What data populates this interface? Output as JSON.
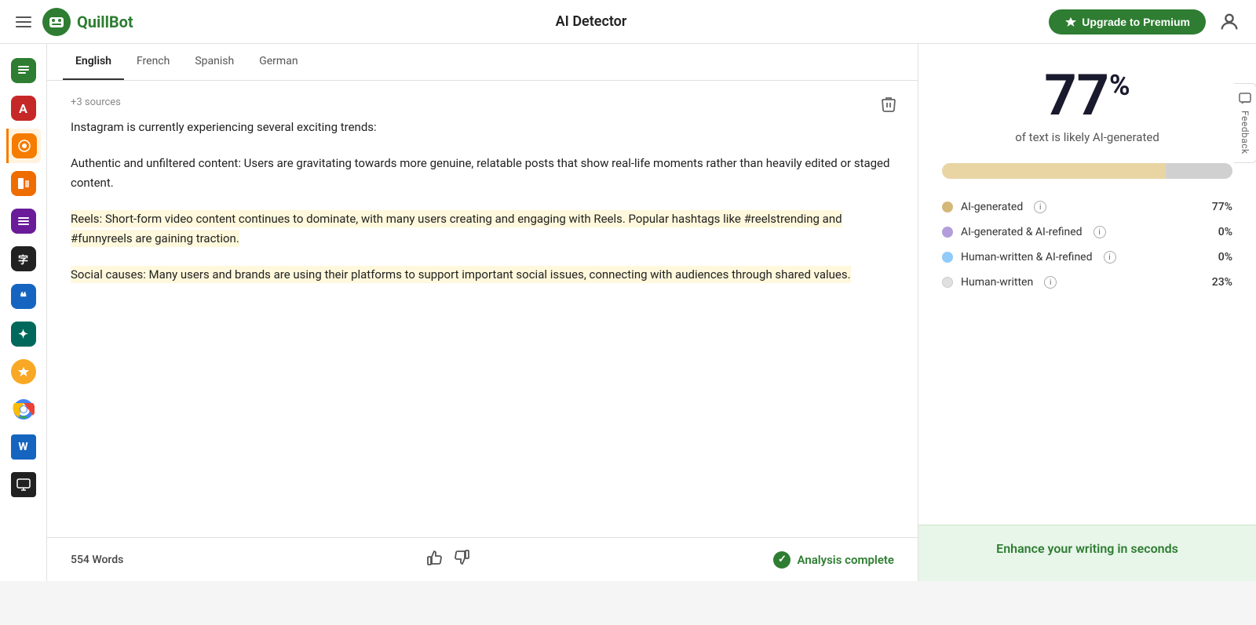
{
  "navbar": {
    "title": "AI Detector",
    "logo_text": "QuillBot",
    "upgrade_label": "Upgrade to Premium"
  },
  "tabs": [
    {
      "label": "English",
      "active": true
    },
    {
      "label": "French",
      "active": false
    },
    {
      "label": "Spanish",
      "active": false
    },
    {
      "label": "German",
      "active": false
    }
  ],
  "content": {
    "sources": "+3 sources",
    "paragraphs": [
      "Instagram is currently experiencing several exciting trends:",
      "Authentic and unfiltered content: Users are gravitating towards more genuine, relatable posts that show real-life moments rather than heavily edited or staged content.",
      "Reels: Short-form video content continues to dominate, with many users creating and engaging with Reels. Popular hashtags like #reelstrending and #funnyreels are gaining traction.",
      "Social causes: Many users and brands are using their platforms to support important social issues, connecting with audiences through shared values."
    ],
    "highlighted": [
      2,
      3
    ],
    "word_count": "554 Words",
    "analysis_status": "Analysis complete"
  },
  "results": {
    "percentage": "77",
    "percent_symbol": "%",
    "likelihood_text": "of text is likely AI-generated",
    "legend": [
      {
        "label": "AI-generated",
        "color": "dot-yellow",
        "value": "77%"
      },
      {
        "label": "AI-generated & AI-refined",
        "color": "dot-purple",
        "value": "0%"
      },
      {
        "label": "Human-written & AI-refined",
        "color": "dot-blue",
        "value": "0%"
      },
      {
        "label": "Human-written",
        "color": "dot-gray",
        "value": "23%"
      }
    ],
    "progress_ai_pct": 77,
    "progress_human_pct": 23
  },
  "promo": {
    "text": "Enhance your writing in seconds"
  },
  "feedback": {
    "label": "Feedback"
  },
  "sidebar": {
    "items": [
      {
        "icon": "📝",
        "class": "ic-green",
        "name": "summarizer"
      },
      {
        "icon": "A",
        "class": "ic-red",
        "name": "grammar-checker"
      },
      {
        "icon": "⊕",
        "class": "ic-orange",
        "name": "ai-detector",
        "active": true
      },
      {
        "icon": "◧",
        "class": "ic-orange2",
        "name": "paraphraser"
      },
      {
        "icon": "≡",
        "class": "ic-purple",
        "name": "text-tools"
      },
      {
        "icon": "字",
        "class": "ic-dark",
        "name": "translator"
      },
      {
        "icon": "❝",
        "class": "ic-blue",
        "name": "citation"
      },
      {
        "icon": "✦",
        "class": "ic-teal",
        "name": "ai-writer"
      },
      {
        "icon": "◆",
        "class": "ic-yellow",
        "name": "premium"
      },
      {
        "icon": "⊕",
        "class": "ic-chrome",
        "name": "chrome-ext"
      },
      {
        "icon": "W",
        "class": "ic-word",
        "name": "word-plugin"
      },
      {
        "icon": "▣",
        "class": "ic-monitor",
        "name": "monitor"
      }
    ]
  }
}
